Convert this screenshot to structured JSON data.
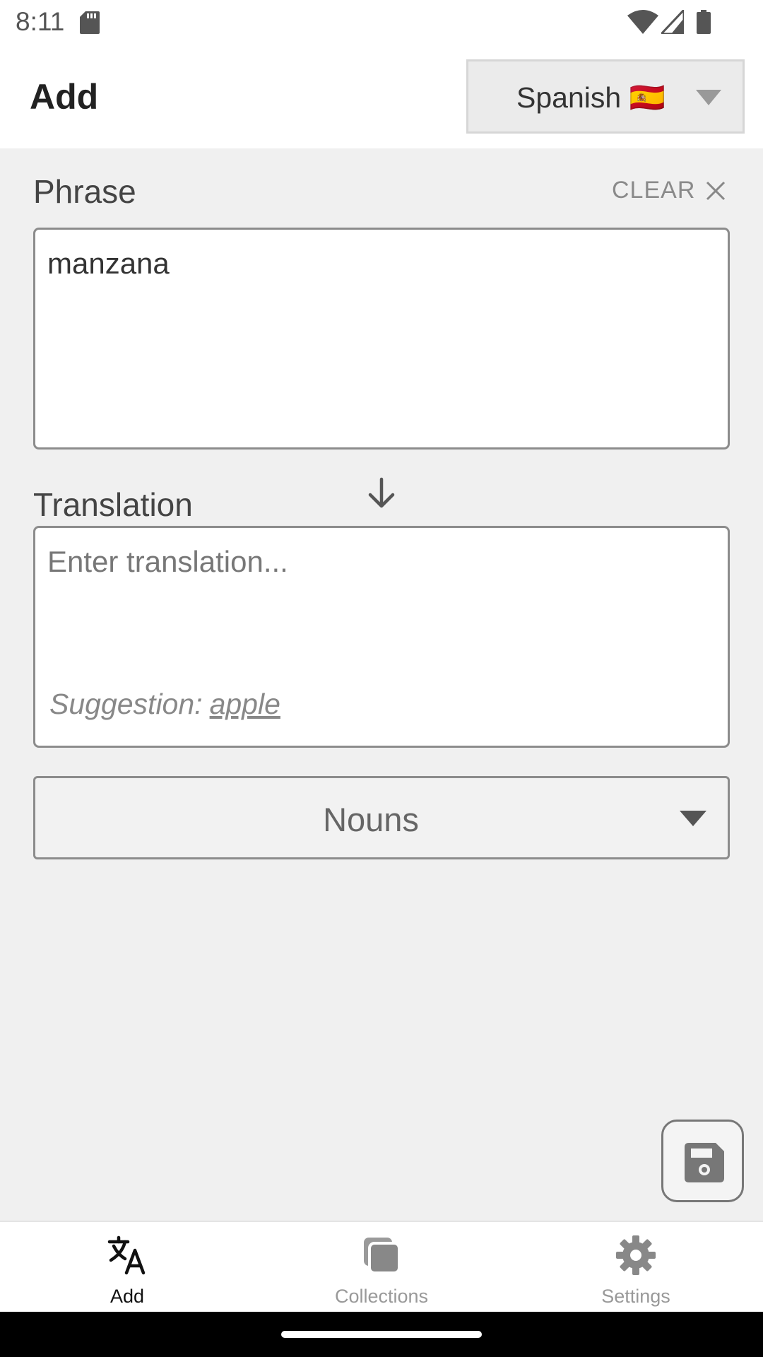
{
  "status_bar": {
    "time": "8:11",
    "icons": [
      "sd-card-icon",
      "wifi-icon",
      "signal-icon",
      "battery-icon"
    ]
  },
  "app_bar": {
    "title": "Add",
    "language_select": {
      "selected": "Spanish 🇪🇸"
    }
  },
  "phrase": {
    "label": "Phrase",
    "clear_label": "CLEAR",
    "value": "manzana"
  },
  "translation": {
    "label": "Translation",
    "placeholder": "Enter translation...",
    "suggestion_prefix": "Suggestion:",
    "suggestion_value": "apple"
  },
  "category_select": {
    "selected": "Nouns"
  },
  "bottom_nav": {
    "items": [
      {
        "label": "Add",
        "icon": "translate-icon",
        "active": true
      },
      {
        "label": "Collections",
        "icon": "collections-icon",
        "active": false
      },
      {
        "label": "Settings",
        "icon": "gear-icon",
        "active": false
      }
    ]
  },
  "colors": {
    "background": "#f0f0f0",
    "surface": "#ffffff",
    "border": "#8c8c8c",
    "active_nav": "#111111",
    "inactive_nav": "#999999"
  }
}
